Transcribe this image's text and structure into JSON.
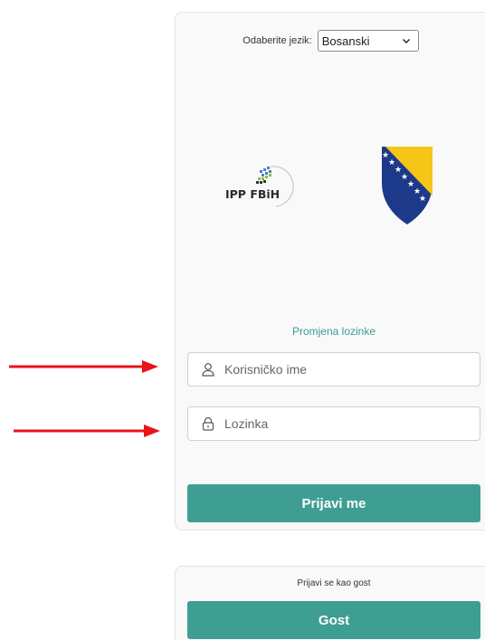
{
  "language": {
    "label": "Odaberite jezik:",
    "selected": "Bosanski"
  },
  "logos": {
    "ipp_text": "IPP FBiH"
  },
  "login": {
    "change_password_link": "Promjena lozinke",
    "username_placeholder": "Korisničko ime",
    "password_placeholder": "Lozinka",
    "submit_label": "Prijavi me"
  },
  "guest": {
    "title": "Prijavi se kao gost",
    "button_label": "Gost"
  },
  "colors": {
    "accent": "#3e9e92",
    "annotation_arrow": "#e8141b",
    "flag_blue": "#1d3a8a",
    "flag_yellow": "#f5c518"
  },
  "icons": {
    "username": "user-icon",
    "password": "lock-icon",
    "dropdown": "chevron-down-icon"
  }
}
